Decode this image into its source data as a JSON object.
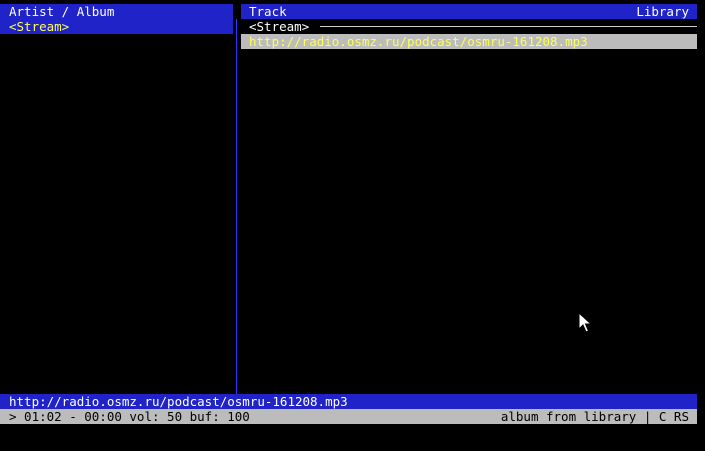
{
  "header": {
    "left_title": "Artist / Album",
    "center_title": "Track",
    "right_title": "Library"
  },
  "left_pane": {
    "items": [
      {
        "label": "<Stream>",
        "selected": true
      }
    ]
  },
  "right_pane": {
    "group_header": "<Stream>",
    "tracks": [
      {
        "label": "http://radio.osmz.ru/podcast/osmru-161208.mp3",
        "selected": true
      }
    ]
  },
  "now_playing": {
    "title": "http://radio.osmz.ru/podcast/osmru-161208.mp3"
  },
  "status_bar": {
    "left": "> 01:02 - 00:00 vol: 50 buf: 100",
    "right": "album from library | C RS"
  },
  "colors": {
    "background": "#000000",
    "title_bar": "#1f23c8",
    "status_bar": "#bcbcbc",
    "selected_text": "#ffff54",
    "pane_divider": "#2e34ff"
  }
}
